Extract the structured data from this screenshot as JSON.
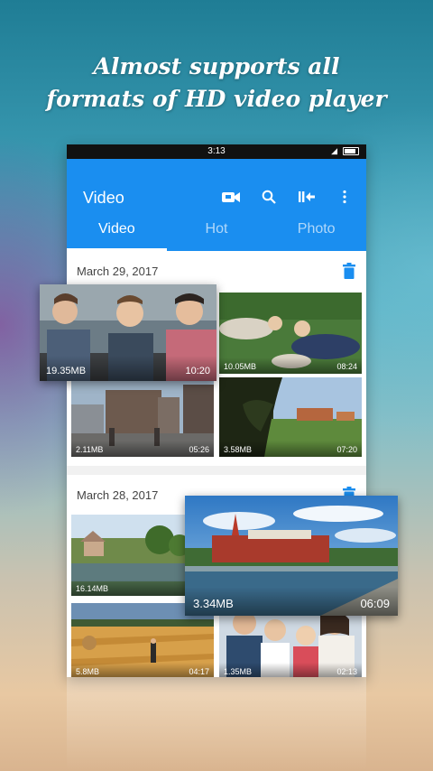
{
  "headline": {
    "line1": "Almost supports all",
    "line2": "formats of HD video player"
  },
  "status_bar": {
    "time": "3:13"
  },
  "app_bar": {
    "title": "Video",
    "icons": [
      "video-camera-icon",
      "search-icon",
      "skip-back-icon",
      "more-vertical-icon"
    ],
    "tabs": [
      {
        "label": "Video",
        "active": true
      },
      {
        "label": "Hot",
        "active": false
      },
      {
        "label": "Photo",
        "active": false
      }
    ]
  },
  "colors": {
    "accent": "#1a8ef0",
    "trash": "#1a8ef0"
  },
  "sections": [
    {
      "date": "March 29, 2017",
      "videos": [
        {
          "size": "19.35MB",
          "duration": "10:20"
        },
        {
          "size": "10.05MB",
          "duration": "08:24"
        },
        {
          "size": "2.11MB",
          "duration": "05:26"
        },
        {
          "size": "3.58MB",
          "duration": "07:20"
        }
      ]
    },
    {
      "date": "March 28, 2017",
      "videos": [
        {
          "size": "16.14MB",
          "duration": ""
        },
        {
          "size": "3.34MB",
          "duration": "06:09"
        },
        {
          "size": "5.8MB",
          "duration": "04:17"
        },
        {
          "size": "1.35MB",
          "duration": "02:13"
        }
      ]
    }
  ]
}
